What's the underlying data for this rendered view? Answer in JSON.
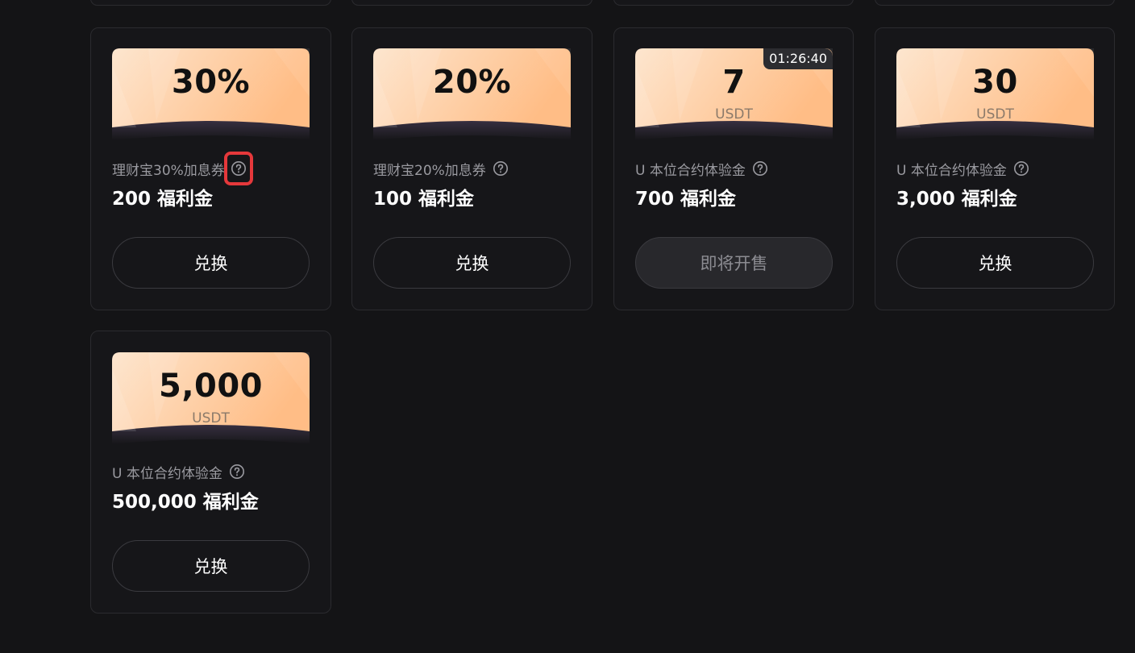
{
  "cards": [
    {
      "ticket_value": "30%",
      "ticket_unit": "",
      "timer": "",
      "title": "理财宝30%加息券",
      "amount": "200 福利金",
      "button_label": "兑换",
      "button_state": "enabled",
      "help_highlighted": true
    },
    {
      "ticket_value": "20%",
      "ticket_unit": "",
      "timer": "",
      "title": "理财宝20%加息券",
      "amount": "100 福利金",
      "button_label": "兑换",
      "button_state": "enabled",
      "help_highlighted": false
    },
    {
      "ticket_value": "7",
      "ticket_unit": "USDT",
      "timer": "01:26:40",
      "title": "U 本位合约体验金",
      "amount": "700 福利金",
      "button_label": "即将开售",
      "button_state": "disabled",
      "help_highlighted": false
    },
    {
      "ticket_value": "30",
      "ticket_unit": "USDT",
      "timer": "",
      "title": "U 本位合约体验金",
      "amount": "3,000 福利金",
      "button_label": "兑换",
      "button_state": "enabled",
      "help_highlighted": false
    },
    {
      "ticket_value": "5,000",
      "ticket_unit": "USDT",
      "timer": "",
      "title": "U 本位合约体验金",
      "amount": "500,000 福利金",
      "button_label": "兑换",
      "button_state": "enabled",
      "help_highlighted": false
    }
  ],
  "icons": {
    "help": "question-circle-icon"
  },
  "colors": {
    "background": "#141416",
    "card_border": "#2b2b2f",
    "ticket_light": "#fde6cf",
    "ticket_dark": "#ffbd86",
    "highlight": "#e5383b",
    "disabled_button": "#28282c"
  }
}
